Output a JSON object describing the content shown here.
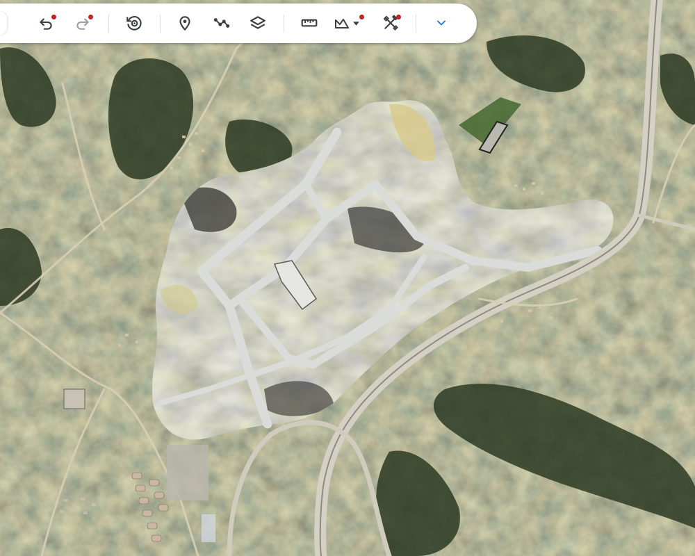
{
  "toolbar": {
    "buttons": [
      {
        "name": "undo",
        "icon": "undo-icon",
        "enabled": true,
        "badge": true
      },
      {
        "name": "redo",
        "icon": "redo-icon",
        "enabled": false,
        "badge": true
      },
      {
        "name": "history",
        "icon": "history-icon",
        "enabled": true,
        "badge": false
      },
      {
        "name": "add-placemark",
        "icon": "placemark-icon",
        "enabled": true,
        "badge": false
      },
      {
        "name": "draw-path",
        "icon": "path-icon",
        "enabled": true,
        "badge": false
      },
      {
        "name": "layers",
        "icon": "layers-icon",
        "enabled": true,
        "badge": false
      },
      {
        "name": "measure",
        "icon": "ruler-icon",
        "enabled": true,
        "badge": false
      },
      {
        "name": "terrain",
        "icon": "terrain-icon",
        "enabled": true,
        "badge": true
      },
      {
        "name": "tools",
        "icon": "tools-icon",
        "enabled": true,
        "badge": true
      },
      {
        "name": "expand",
        "icon": "chevron-down-icon",
        "enabled": true,
        "badge": false
      }
    ]
  },
  "colors": {
    "icon": "#3c4043",
    "icon_disabled": "#9aa0a6",
    "badge": "#c5221f",
    "accent": "#1a73e8"
  }
}
